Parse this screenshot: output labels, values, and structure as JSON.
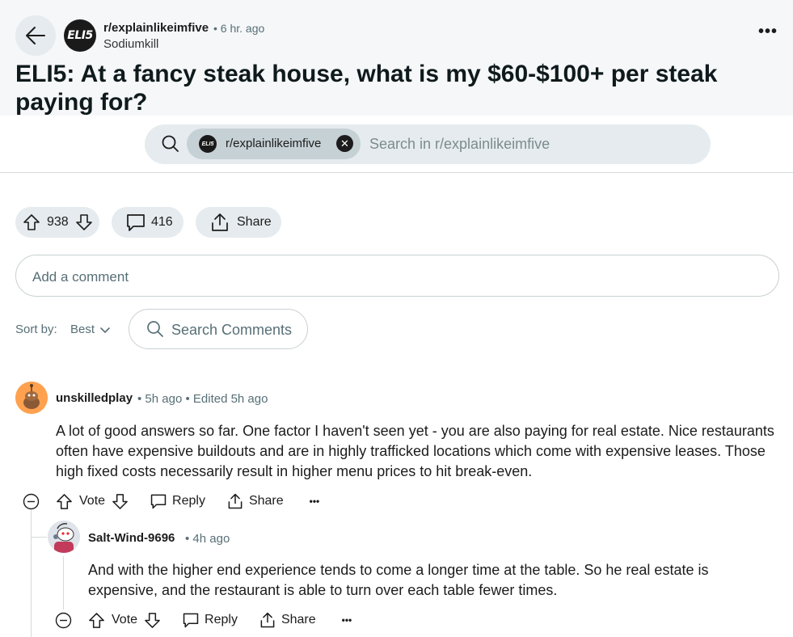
{
  "post": {
    "subreddit": "r/explainlikeimfive",
    "time": "• 6 hr. ago",
    "author": "Sodiumkill",
    "logo_text": "ELI5",
    "title": "ELI5: At a fancy steak house, what is my $60-$100+ per steak paying for?"
  },
  "search": {
    "chip_label": "r/explainlikeimfive",
    "placeholder": "Search in r/explainlikeimfive"
  },
  "post_actions": {
    "votes": "938",
    "comments": "416",
    "share": "Share"
  },
  "add_comment_placeholder": "Add a comment",
  "sort": {
    "label": "Sort by:",
    "value": "Best"
  },
  "search_comments_placeholder": "Search Comments",
  "comments": [
    {
      "author": "unskilledplay",
      "meta": "• 5h ago • Edited 5h ago",
      "body": "A lot of good answers so far. One factor I haven't seen yet - you are also paying for real estate. Nice restaurants often have expensive buildouts and are in highly trafficked locations which come with expensive leases. Those high fixed costs necessarily result in higher menu prices to hit break-even.",
      "vote": "Vote",
      "reply": "Reply",
      "share": "Share"
    },
    {
      "author": "Salt-Wind-9696",
      "meta": "• 4h ago",
      "body": "And with the higher end experience tends to come a longer time at the table. So he real estate is expensive, and the restaurant is able to turn over each table fewer times.",
      "vote": "Vote",
      "reply": "Reply",
      "share": "Share"
    }
  ],
  "colors": {
    "bg_top": "#f6f7f9",
    "pill": "#e5ebee",
    "chip": "#c6d1d6",
    "muted": "#576f76"
  }
}
